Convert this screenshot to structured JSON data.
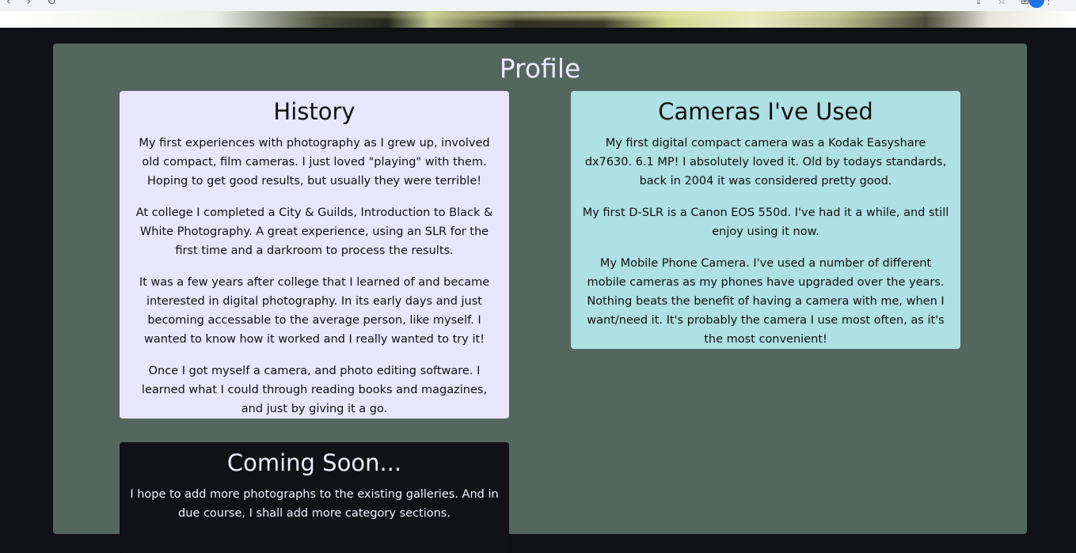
{
  "colors": {
    "page_background": "#0f1114",
    "panel_background": "#55665e",
    "history_card": "#e8e6fc",
    "cameras_card": "#aee0e4",
    "coming_soon_card": "#101215",
    "title_text": "#eaeaff"
  },
  "browser": {
    "icons": [
      "back-arrow-icon",
      "forward-arrow-icon",
      "reload-icon",
      "lock-icon",
      "share-icon",
      "star-icon",
      "extensions-icon",
      "profile-avatar"
    ]
  },
  "page": {
    "title": "Profile"
  },
  "history": {
    "heading": "History",
    "paragraphs": [
      "My first experiences with photography as I grew up, involved old compact, film cameras. I just loved \"playing\" with them. Hoping to get good results, but usually they were terrible!",
      "At college I completed a City & Guilds, Introduction to Black & White Photography. A great experience, using an SLR for the first time and a darkroom to process the results.",
      "It was a few years after college that I learned of and became interested in digital photography. In its early days and just becoming accessable to the average person, like myself. I wanted to know how it worked and I really wanted to try it!",
      "Once I got myself a camera, and photo editing software. I learned what I could through reading books and magazines, and just by giving it a go."
    ]
  },
  "cameras": {
    "heading": "Cameras I've Used",
    "paragraphs": [
      "My first digital compact camera was a Kodak Easyshare dx7630. 6.1 MP! I absolutely loved it. Old by todays standards, back in 2004 it was considered pretty good.",
      "My first D-SLR is a Canon EOS 550d. I've had it a while, and still enjoy using it now.",
      "My Mobile Phone Camera. I've used a number of different mobile cameras as my phones have upgraded over the years. Nothing beats the benefit of having a camera with me, when I want/need it. It's probably the camera I use most often, as it's the most convenient!"
    ]
  },
  "coming_soon": {
    "heading": "Coming Soon...",
    "paragraphs": [
      "I hope to add more photographs to the existing galleries. And in due course, I shall add more category sections."
    ]
  }
}
